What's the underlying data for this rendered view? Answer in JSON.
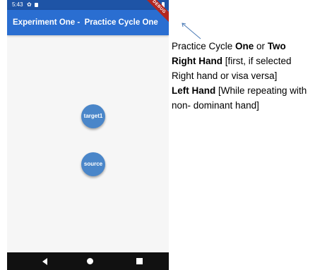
{
  "status_bar": {
    "time": "5:43",
    "settings_icon": "gear-icon",
    "sim_icon": "sim-card-icon",
    "wifi_icon": "wifi-icon",
    "battery_icon": "battery-icon"
  },
  "app_bar": {
    "title": "Experiment One -  Practice Cycle One",
    "debug_banner": "DEBUG",
    "color": "#2a6ed1"
  },
  "nodes": {
    "target": "target1",
    "source": "source",
    "color": "#4a86c9"
  },
  "nav_bar": {
    "back_icon": "back-triangle-icon",
    "home_icon": "home-circle-icon",
    "recent_icon": "recent-square-icon"
  },
  "annotation": {
    "line1_prefix": "Practice Cycle ",
    "line1_bold1": "One",
    "line1_mid": " or ",
    "line1_bold2": "Two",
    "line2_bold": "Right Hand",
    "line2_rest": " [first, if selected Right hand or visa versa]",
    "line3_bold": "Left Hand",
    "line3_rest": " [While repeating with non- dominant hand]"
  }
}
